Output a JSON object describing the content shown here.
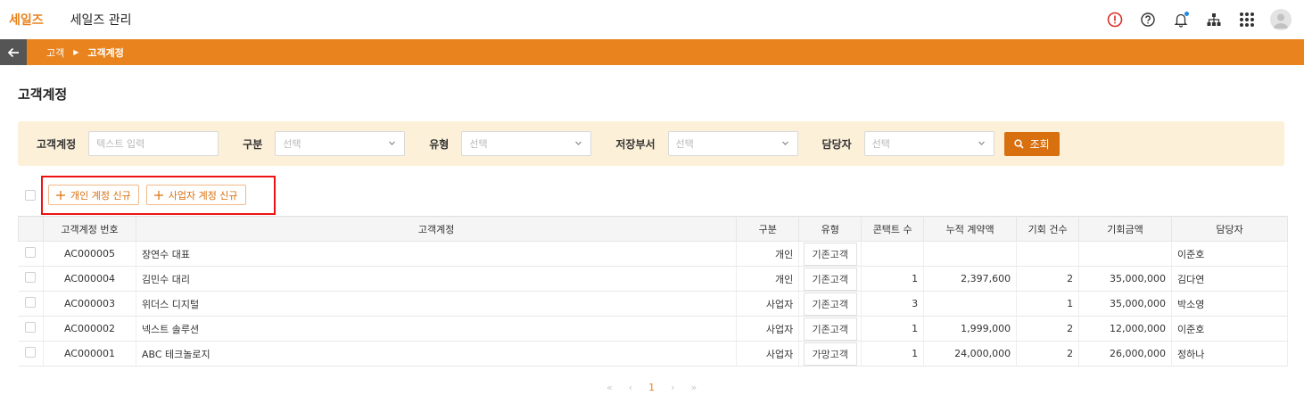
{
  "header": {
    "logo": "세일즈",
    "app_title": "세일즈 관리"
  },
  "breadcrumb": [
    "고객",
    "고객계정"
  ],
  "page_title": "고객계정",
  "filters": {
    "account_label": "고객계정",
    "account_placeholder": "텍스트 입력",
    "category_label": "구분",
    "category_value": "선택",
    "type_label": "유형",
    "type_value": "선택",
    "dept_label": "저장부서",
    "dept_value": "선택",
    "owner_label": "담당자",
    "owner_value": "선택",
    "search_label": "조회"
  },
  "actions": {
    "new_personal": "개인 계정 신규",
    "new_business": "사업자 계정 신규"
  },
  "table": {
    "columns": [
      "고객계정 번호",
      "고객계정",
      "구분",
      "유형",
      "콘택트 수",
      "누적 계약액",
      "기회 건수",
      "기회금액",
      "담당자"
    ],
    "rows": [
      {
        "id": "AC000005",
        "name": "장연수 대표",
        "category": "개인",
        "type": "기존고객",
        "contacts": "",
        "contract": "",
        "opps": "",
        "opp_amount": "",
        "owner": "이준호"
      },
      {
        "id": "AC000004",
        "name": "김민수 대리",
        "category": "개인",
        "type": "기존고객",
        "contacts": "1",
        "contract": "2,397,600",
        "opps": "2",
        "opp_amount": "35,000,000",
        "owner": "김다연"
      },
      {
        "id": "AC000003",
        "name": "위더스 디지털",
        "category": "사업자",
        "type": "기존고객",
        "contacts": "3",
        "contract": "",
        "opps": "1",
        "opp_amount": "35,000,000",
        "owner": "박소영"
      },
      {
        "id": "AC000002",
        "name": "넥스트 솔루션",
        "category": "사업자",
        "type": "기존고객",
        "contacts": "1",
        "contract": "1,999,000",
        "opps": "2",
        "opp_amount": "12,000,000",
        "owner": "이준호"
      },
      {
        "id": "AC000001",
        "name": "ABC 테크놀로지",
        "category": "사업자",
        "type": "가망고객",
        "contacts": "1",
        "contract": "24,000,000",
        "opps": "2",
        "opp_amount": "26,000,000",
        "owner": "정하나"
      }
    ]
  },
  "pagination": {
    "first": "«",
    "prev": "‹",
    "current": "1",
    "next": "›",
    "last": "»"
  },
  "colors": {
    "accent": "#e8831d",
    "filter_bg": "#fdf0d9",
    "highlight_box": "#ee1111"
  }
}
